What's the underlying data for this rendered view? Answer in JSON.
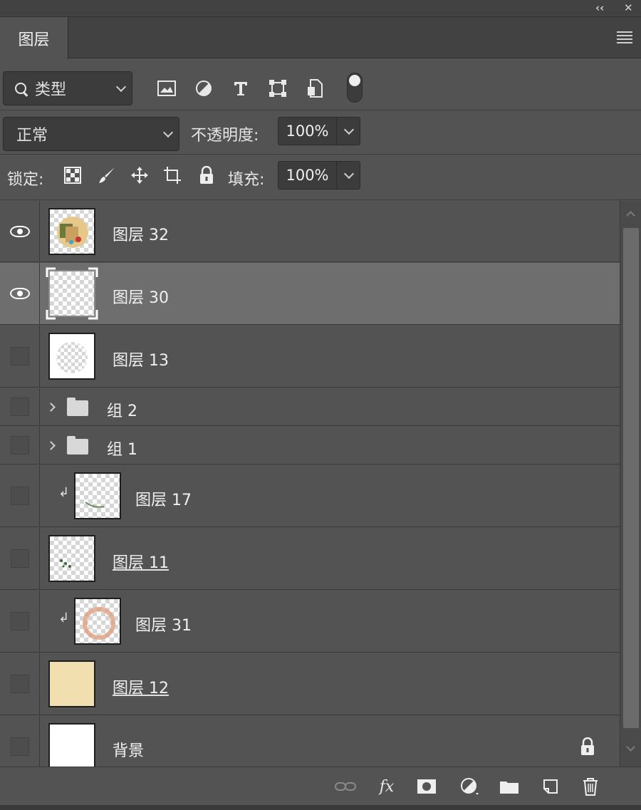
{
  "panel": {
    "tab_label": "图层",
    "collapse_glyph": "‹‹",
    "close_glyph": "✕"
  },
  "filter": {
    "kind_label": "类型",
    "icons": [
      "image-filter-icon",
      "adjustment-filter-icon",
      "type-filter-icon",
      "shape-filter-icon",
      "smart-object-filter-icon"
    ]
  },
  "blend": {
    "mode": "正常",
    "opacity_label": "不透明度:",
    "opacity_value": "100%"
  },
  "lock": {
    "label": "锁定:",
    "fill_label": "填充:",
    "fill_value": "100%"
  },
  "layers": [
    {
      "name": "图层 32",
      "visible": true,
      "selected": false,
      "kind": "layer",
      "thumb": "photo"
    },
    {
      "name": "图层 30",
      "visible": true,
      "selected": true,
      "kind": "layer",
      "thumb": "transparent"
    },
    {
      "name": "图层 13",
      "visible": false,
      "selected": false,
      "kind": "layer",
      "thumb": "transparent"
    },
    {
      "name": "组 2",
      "visible": false,
      "selected": false,
      "kind": "group"
    },
    {
      "name": "组 1",
      "visible": false,
      "selected": false,
      "kind": "group"
    },
    {
      "name": "图层 17",
      "visible": false,
      "selected": false,
      "kind": "clipped",
      "thumb": "transparent"
    },
    {
      "name": "图层 11",
      "visible": false,
      "selected": false,
      "kind": "layer",
      "thumb": "transparent",
      "underlined": true
    },
    {
      "name": "图层 31",
      "visible": false,
      "selected": false,
      "kind": "clipped",
      "thumb": "transparent"
    },
    {
      "name": "图层 12",
      "visible": false,
      "selected": false,
      "kind": "layer",
      "thumb": "cream",
      "underlined": true
    },
    {
      "name": "背景",
      "visible": false,
      "selected": false,
      "kind": "background",
      "thumb": "white",
      "locked": true
    }
  ],
  "colors": {
    "panel_bg": "#535353",
    "selected_row": "#6e6e6e",
    "cream_fill": "#f2dfb0"
  }
}
